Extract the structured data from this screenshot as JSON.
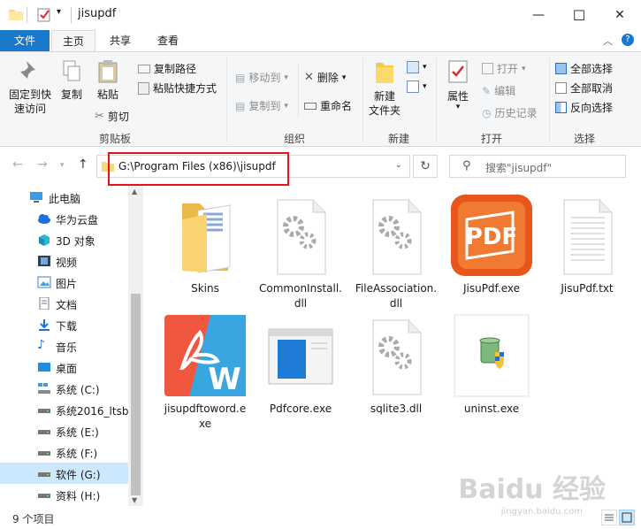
{
  "window": {
    "title": "jisupdf",
    "minimize": "—",
    "maximize": "☐",
    "close": "✕"
  },
  "ribbon": {
    "tabs": [
      "文件",
      "主页",
      "共享",
      "查看"
    ],
    "active_tab": "主页",
    "clipboard": {
      "pin": "固定到快速访问",
      "pin_line1": "固定到快",
      "pin_line2": "速访问",
      "copy": "复制",
      "paste": "粘贴",
      "copy_path": "复制路径",
      "paste_shortcut": "粘贴快捷方式",
      "cut": "剪切",
      "label": "剪贴板"
    },
    "organize": {
      "move_to": "移动到",
      "copy_to": "复制到",
      "delete": "删除",
      "rename": "重命名",
      "label": "组织"
    },
    "new": {
      "new_folder_line1": "新建",
      "new_folder_line2": "文件夹",
      "label": "新建"
    },
    "open": {
      "properties": "属性",
      "open": "打开",
      "edit": "编辑",
      "history": "历史记录",
      "label": "打开"
    },
    "select": {
      "select_all": "全部选择",
      "select_none": "全部取消",
      "invert": "反向选择",
      "label": "选择"
    }
  },
  "address": {
    "path": "G:\\Program Files (x86)\\jisupdf",
    "search_placeholder": "搜索\"jisupdf\""
  },
  "nav": {
    "items": [
      {
        "label": "此电脑",
        "icon": "pc-icon"
      },
      {
        "label": "华为云盘",
        "icon": "cloud-icon"
      },
      {
        "label": "3D 对象",
        "icon": "cube-icon"
      },
      {
        "label": "视频",
        "icon": "video-icon"
      },
      {
        "label": "图片",
        "icon": "picture-icon"
      },
      {
        "label": "文档",
        "icon": "document-icon"
      },
      {
        "label": "下载",
        "icon": "download-icon"
      },
      {
        "label": "音乐",
        "icon": "music-icon"
      },
      {
        "label": "桌面",
        "icon": "desktop-icon"
      },
      {
        "label": "系统 (C:)",
        "icon": "windows-drive-icon"
      },
      {
        "label": "系统2016_ltsb",
        "icon": "drive-icon"
      },
      {
        "label": "系统 (E:)",
        "icon": "drive-icon"
      },
      {
        "label": "系统 (F:)",
        "icon": "drive-icon"
      },
      {
        "label": "软件 (G:)",
        "icon": "drive-icon"
      },
      {
        "label": "资料 (H:)",
        "icon": "drive-icon"
      }
    ],
    "selected": "软件 (G:)"
  },
  "files": [
    {
      "name": "Skins",
      "kind": "folder"
    },
    {
      "name": "CommonInstall.dll",
      "line1": "CommonInstall.",
      "line2": "dll",
      "kind": "dll"
    },
    {
      "name": "FileAssociation.dll",
      "line1": "FileAssociation.",
      "line2": "dll",
      "kind": "dll"
    },
    {
      "name": "JisuPdf.exe",
      "kind": "pdf-app"
    },
    {
      "name": "JisuPdf.txt",
      "kind": "txt"
    },
    {
      "name": "jisupdftoword.exe",
      "line1": "jisupdftoword.e",
      "line2": "xe",
      "kind": "word-app"
    },
    {
      "name": "Pdfcore.exe",
      "kind": "window-app"
    },
    {
      "name": "sqlite3.dll",
      "kind": "dll"
    },
    {
      "name": "uninst.exe",
      "kind": "uninstaller"
    }
  ],
  "status": {
    "count": "9 个项目"
  },
  "watermark": {
    "main": "Baidu 经验",
    "sub": "jingyan.baidu.com"
  },
  "colors": {
    "accent": "#1979ca",
    "highlight_box": "#e0151b",
    "selected_nav": "#cce8ff",
    "pdf_orange": "#e8561b",
    "word_red": "#f0573f",
    "word_blue": "#3aa6e0"
  }
}
